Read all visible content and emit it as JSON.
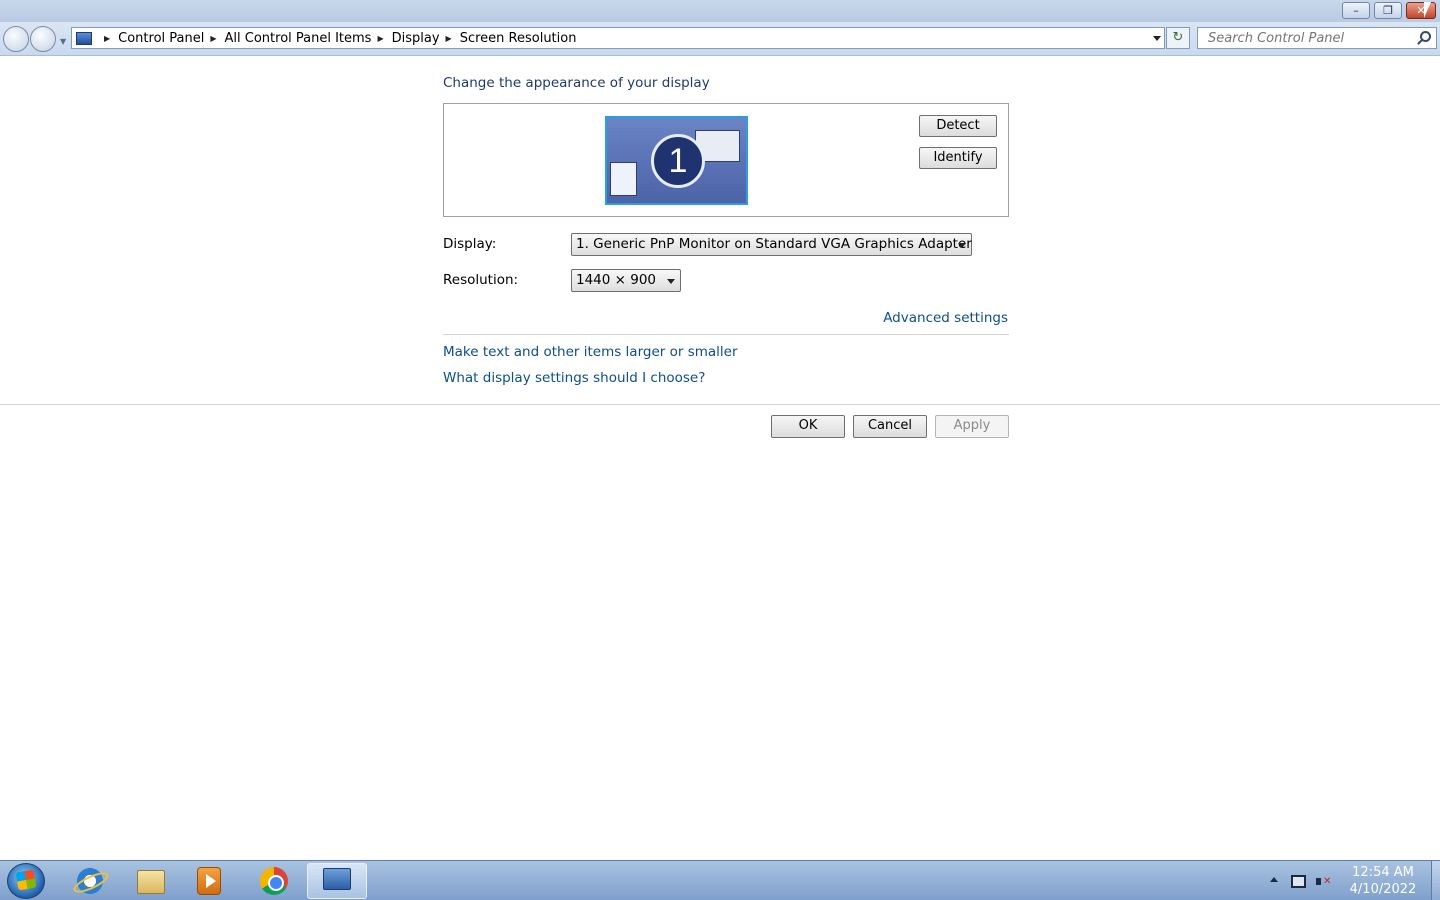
{
  "titlebar": {
    "minimize_icon": "minimize-icon",
    "maximize_icon": "restore-icon",
    "close_icon": "close-icon",
    "minimize_glyph": "–",
    "restore_glyph": "❐",
    "close_glyph": "✕"
  },
  "address_bar": {
    "breadcrumbs": [
      "Control Panel",
      "All Control Panel Items",
      "Display",
      "Screen Resolution"
    ],
    "search_placeholder": "Search Control Panel"
  },
  "main": {
    "heading": "Change the appearance of your display",
    "monitor_number": "1",
    "detect_label": "Detect",
    "identify_label": "Identify",
    "display_label": "Display:",
    "display_value": "1. Generic PnP Monitor on Standard VGA Graphics Adapter",
    "resolution_label": "Resolution:",
    "resolution_value": "1440 × 900",
    "advanced_link": "Advanced settings",
    "text_size_link": "Make text and other items larger or smaller",
    "what_settings_link": "What display settings should I choose?"
  },
  "buttons": {
    "ok": "OK",
    "cancel": "Cancel",
    "apply": "Apply"
  },
  "taskbar": {
    "apps": [
      "internet-explorer-icon",
      "windows-explorer-icon",
      "media-player-icon",
      "chrome-icon",
      "control-panel-icon"
    ],
    "time": "12:54 AM",
    "date": "4/10/2022"
  },
  "colors": {
    "link": "#0c4f8c",
    "heading": "#1e3b6e",
    "taskbar": "#8fabd4"
  }
}
